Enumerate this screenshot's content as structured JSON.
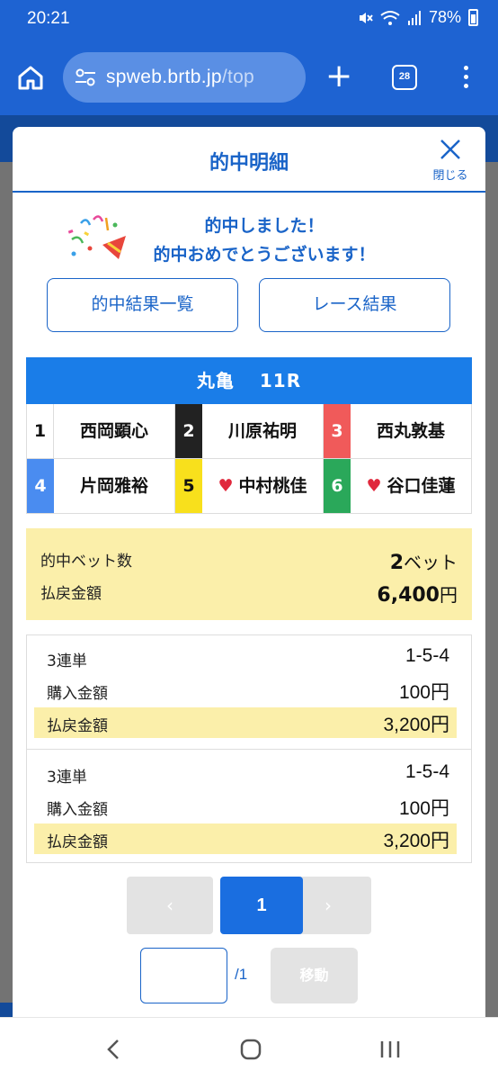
{
  "status_bar": {
    "time": "20:21",
    "battery": "78%"
  },
  "browser": {
    "url_host": "spweb.brtb.jp",
    "url_path": "/top",
    "tab_count": "28"
  },
  "modal": {
    "title": "的中明細",
    "close_label": "閉じる",
    "congrats": {
      "line1": "的中しました！",
      "line2": "的中おめでとうございます！"
    },
    "buttons": {
      "results_list": "的中結果一覧",
      "race_results": "レース結果"
    },
    "race": {
      "venue": "丸亀",
      "race_no": "11R"
    },
    "racers": [
      {
        "num": "1",
        "name": "西岡顕心",
        "female": false
      },
      {
        "num": "2",
        "name": "川原祐明",
        "female": false
      },
      {
        "num": "3",
        "name": "西丸敦基",
        "female": false
      },
      {
        "num": "4",
        "name": "片岡雅裕",
        "female": false
      },
      {
        "num": "5",
        "name": "中村桃佳",
        "female": true
      },
      {
        "num": "6",
        "name": "谷口佳蓮",
        "female": true
      }
    ],
    "summary": {
      "hit_count_label": "的中ベット数",
      "hit_count_value": "2",
      "hit_count_unit": "ベット",
      "payout_label": "払戻金額",
      "payout_value": "6,400",
      "payout_unit": "円"
    },
    "bets": [
      {
        "type": "3連単",
        "combo": "1-5-4",
        "purchase_label": "購入金額",
        "purchase_value": "100円",
        "payout_label": "払戻金額",
        "payout_value": "3,200円"
      },
      {
        "type": "3連単",
        "combo": "1-5-4",
        "purchase_label": "購入金額",
        "purchase_value": "100円",
        "payout_label": "払戻金額",
        "payout_value": "3,200円"
      }
    ],
    "pagination": {
      "prev": "‹",
      "current": "1",
      "next": "›",
      "total": "/1",
      "jump_label": "移動"
    }
  },
  "colors": {
    "primary": "#1a64c8",
    "header_blue": "#1e63d2",
    "highlight": "#fbefaa"
  }
}
